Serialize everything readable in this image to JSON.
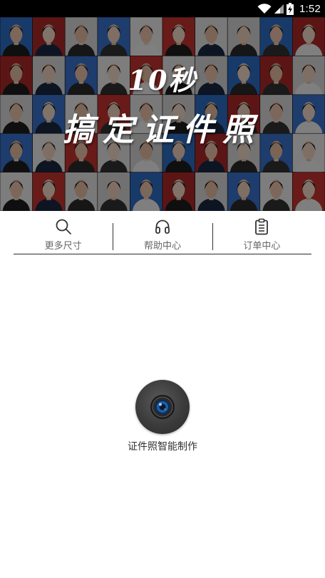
{
  "status_bar": {
    "time": "1:52",
    "icons": [
      "wifi-icon",
      "signal-icon",
      "battery-charging-icon"
    ]
  },
  "banner": {
    "line1": "10秒",
    "line2": "搞定证件照"
  },
  "nav": [
    {
      "label": "更多尺寸",
      "icon": "search-icon"
    },
    {
      "label": "帮助中心",
      "icon": "headphones-icon"
    },
    {
      "label": "订单中心",
      "icon": "clipboard-icon"
    }
  ],
  "camera": {
    "label": "证件照智能制作",
    "icon": "camera-lens-icon"
  },
  "colors": {
    "status_bar_bg": "#000000",
    "text_primary": "#333333",
    "text_secondary": "#666666",
    "divider": "#2a2a2a"
  }
}
